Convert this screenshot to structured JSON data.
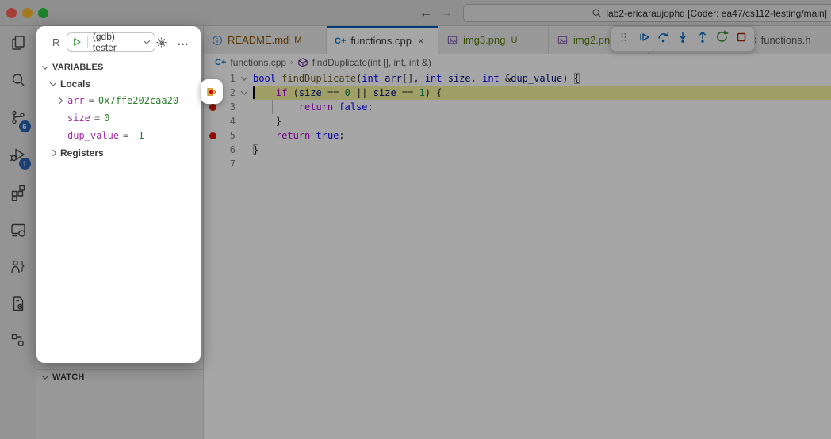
{
  "titlebar": {
    "search_text": "lab2-ericaraujophd [Coder: ea47/cs112-testing/main]"
  },
  "activity_bar": {
    "items": [
      {
        "id": "explorer",
        "icon": "files-icon"
      },
      {
        "id": "search",
        "icon": "search-icon"
      },
      {
        "id": "source-control",
        "icon": "source-control-icon",
        "badge": "6"
      },
      {
        "id": "run-and-debug",
        "icon": "debug-icon",
        "badge": "1"
      },
      {
        "id": "extensions",
        "icon": "extensions-icon"
      },
      {
        "id": "remote-explorer",
        "icon": "remote-icon"
      },
      {
        "id": "accessibility",
        "icon": "person-bracket-icon"
      },
      {
        "id": "runner-settings",
        "icon": "file-gear-icon"
      },
      {
        "id": "hierarchy",
        "icon": "hierarchy-icon"
      }
    ]
  },
  "debug_panel": {
    "panel_label": "R",
    "launch_config": "(gdb) tester",
    "variables_header": "VARIABLES",
    "locals_label": "Locals",
    "locals": [
      {
        "name": "arr",
        "value": "0x7ffe202caa20",
        "expandable": true
      },
      {
        "name": "size",
        "value": "0",
        "expandable": false
      },
      {
        "name": "dup_value",
        "value": "-1",
        "expandable": false
      }
    ],
    "registers_label": "Registers",
    "watch_header": "WATCH"
  },
  "tabs": [
    {
      "label": "README.md",
      "icon": "info-icon",
      "badge": "M",
      "state": "modified"
    },
    {
      "label": "functions.cpp",
      "icon": "cpp-icon",
      "active": true,
      "close_icon": "close-icon"
    },
    {
      "label": "img3.png",
      "icon": "image-icon",
      "badge": "U",
      "state": "untracked"
    },
    {
      "label": "img2.png",
      "icon": "image-icon",
      "state": "untracked"
    },
    {
      "label": "",
      "icon": "",
      "obscured": true
    },
    {
      "label": "functions.h",
      "icon": "c-icon"
    }
  ],
  "debug_toolbar": {
    "buttons": [
      {
        "id": "drag-handle",
        "icon": "grip-icon"
      },
      {
        "id": "continue",
        "icon": "continue-icon"
      },
      {
        "id": "step-over",
        "icon": "step-over-icon"
      },
      {
        "id": "step-into",
        "icon": "step-into-icon"
      },
      {
        "id": "step-out",
        "icon": "step-out-icon"
      },
      {
        "id": "restart",
        "icon": "restart-icon"
      },
      {
        "id": "stop",
        "icon": "stop-icon"
      }
    ]
  },
  "breadcrumb": {
    "file": "functions.cpp",
    "symbol": "findDuplicate(int [], int, int &)"
  },
  "editor": {
    "current_line": 2,
    "breakpoint_lines": [
      3,
      5
    ],
    "fold_lines": [
      1,
      2
    ],
    "guide_lines": [
      3
    ],
    "lines": [
      {
        "num": "1",
        "tokens": [
          {
            "t": "bool",
            "s": "k"
          },
          {
            "t": " ",
            "s": "p"
          },
          {
            "t": "findDuplicate",
            "s": "f"
          },
          {
            "t": "(",
            "s": "p"
          },
          {
            "t": "int",
            "s": "k"
          },
          {
            "t": " ",
            "s": "p"
          },
          {
            "t": "arr",
            "s": "v"
          },
          {
            "t": "[], ",
            "s": "p"
          },
          {
            "t": "int",
            "s": "k"
          },
          {
            "t": " ",
            "s": "p"
          },
          {
            "t": "size",
            "s": "v"
          },
          {
            "t": ", ",
            "s": "p"
          },
          {
            "t": "int",
            "s": "k"
          },
          {
            "t": " &",
            "s": "p"
          },
          {
            "t": "dup_value",
            "s": "v"
          },
          {
            "t": ") ",
            "s": "p"
          },
          {
            "t": "{",
            "s": "b"
          }
        ]
      },
      {
        "num": "2",
        "tokens": [
          {
            "t": "    ",
            "s": "p"
          },
          {
            "t": "if",
            "s": "c"
          },
          {
            "t": " (",
            "s": "p"
          },
          {
            "t": "size",
            "s": "v"
          },
          {
            "t": " == ",
            "s": "p"
          },
          {
            "t": "0",
            "s": "n"
          },
          {
            "t": " || ",
            "s": "p"
          },
          {
            "t": "size",
            "s": "v"
          },
          {
            "t": " == ",
            "s": "p"
          },
          {
            "t": "1",
            "s": "n"
          },
          {
            "t": ") {",
            "s": "p"
          }
        ]
      },
      {
        "num": "3",
        "tokens": [
          {
            "t": "        ",
            "s": "p"
          },
          {
            "t": "return",
            "s": "c"
          },
          {
            "t": " ",
            "s": "p"
          },
          {
            "t": "false",
            "s": "k"
          },
          {
            "t": ";",
            "s": "p"
          }
        ]
      },
      {
        "num": "4",
        "tokens": [
          {
            "t": "    }",
            "s": "p"
          }
        ]
      },
      {
        "num": "5",
        "tokens": [
          {
            "t": "    ",
            "s": "p"
          },
          {
            "t": "return",
            "s": "c"
          },
          {
            "t": " ",
            "s": "p"
          },
          {
            "t": "true",
            "s": "k"
          },
          {
            "t": ";",
            "s": "p"
          }
        ]
      },
      {
        "num": "6",
        "tokens": [
          {
            "t": "}",
            "s": "b"
          }
        ]
      },
      {
        "num": "7",
        "tokens": []
      }
    ]
  },
  "colors": {
    "accent_blue": "#005fb8",
    "breakpoint_red": "#e51400",
    "modified_gold": "#895503",
    "untracked_green": "#587c0c",
    "current_line_highlight": "#f7f5a0"
  }
}
